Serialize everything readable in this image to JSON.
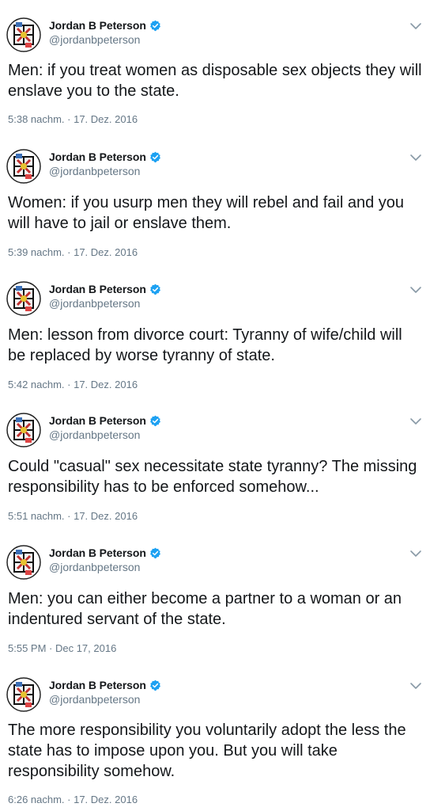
{
  "tweets": [
    {
      "display_name": "Jordan B Peterson",
      "handle": "@jordanbpeterson",
      "text": "Men: if you treat women as disposable sex objects they will enslave you to the state.",
      "timestamp": "5:38 nachm. · 17. Dez. 2016",
      "verified": true
    },
    {
      "display_name": "Jordan B Peterson",
      "handle": "@jordanbpeterson",
      "text": "Women: if you usurp men they will rebel and fail and you will have to jail or enslave them.",
      "timestamp": "5:39 nachm. · 17. Dez. 2016",
      "verified": true
    },
    {
      "display_name": "Jordan B Peterson",
      "handle": "@jordanbpeterson",
      "text": "Men: lesson from divorce court: Tyranny of wife/child will be replaced by worse tyranny of state.",
      "timestamp": "5:42 nachm. · 17. Dez. 2016",
      "verified": true
    },
    {
      "display_name": "Jordan B Peterson",
      "handle": "@jordanbpeterson",
      "text": "Could \"casual\" sex necessitate state tyranny? The missing responsibility has to be enforced somehow...",
      "timestamp": "5:51 nachm. · 17. Dez. 2016",
      "verified": true
    },
    {
      "display_name": "Jordan B Peterson",
      "handle": "@jordanbpeterson",
      "text": "Men: you can either become a partner to a woman or an indentured servant of the state.",
      "timestamp": "5:55 PM · Dec 17, 2016",
      "verified": true
    },
    {
      "display_name": "Jordan B Peterson",
      "handle": "@jordanbpeterson",
      "text": "The more responsibility you voluntarily adopt the less the state has to impose upon you. But you will take responsibility somehow.",
      "timestamp": "6:26 nachm. · 17. Dez. 2016",
      "verified": true
    }
  ],
  "icons": {
    "verified": "verified-badge-icon",
    "chevron": "chevron-down-icon",
    "avatar": "avatar"
  },
  "colors": {
    "text": "#14171a",
    "secondary": "#657786",
    "verified_blue": "#1da1f2"
  }
}
